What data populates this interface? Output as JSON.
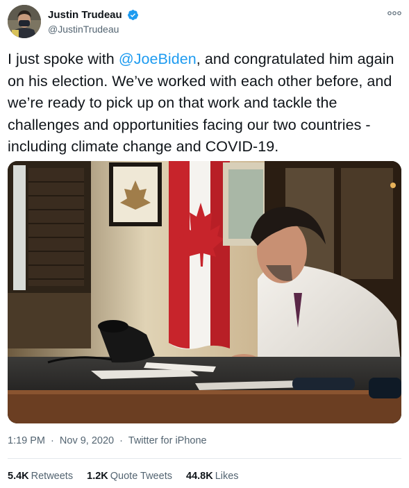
{
  "author": {
    "display_name": "Justin Trudeau",
    "handle": "@JustinTrudeau",
    "verified_badge_icon": "verified-check-icon",
    "verified_color": "#1d9bf0"
  },
  "more_menu_icon": "more-options-icon",
  "tweet": {
    "text_before_mention": "I just spoke with ",
    "mention": "@JoeBiden",
    "text_after_mention": ", and congratulated him again on his election. We’ve worked with each other before, and we’re ready to pick up on that work and tackle the challenges and opportunities facing our two countries - including climate change and COVID-19.",
    "mention_color": "#1d9bf0"
  },
  "metadata": {
    "time": "1:19 PM",
    "date": "Nov 9, 2020",
    "separator": "·",
    "source": "Twitter for iPhone"
  },
  "stats": {
    "retweets_count": "5.4K",
    "retweets_label": "Retweets",
    "quote_count": "1.2K",
    "quote_label": "Quote Tweets",
    "likes_count": "44.8K",
    "likes_label": "Likes"
  }
}
